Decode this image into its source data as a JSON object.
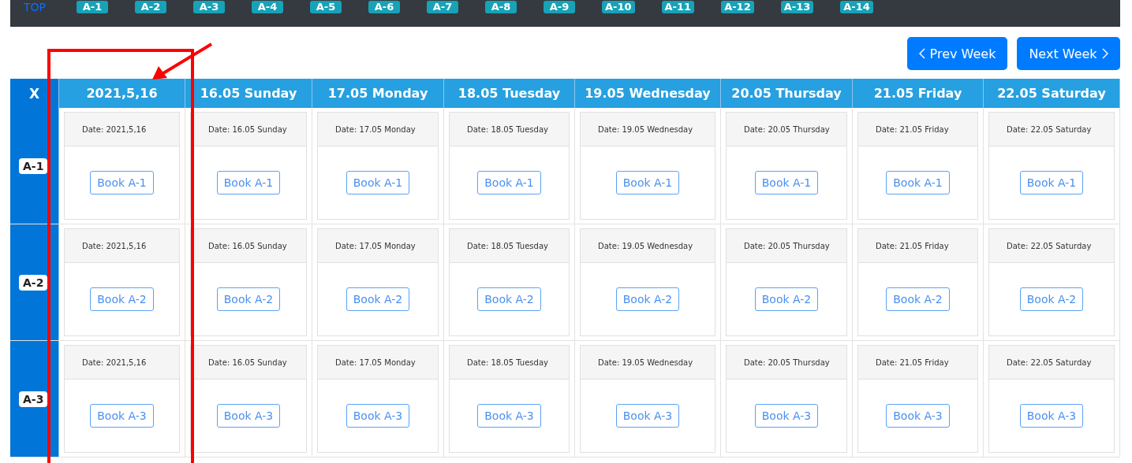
{
  "nav": {
    "top_link": "TOP",
    "badges": [
      "A-1",
      "A-2",
      "A-3",
      "A-4",
      "A-5",
      "A-6",
      "A-7",
      "A-8",
      "A-9",
      "A-10",
      "A-11",
      "A-12",
      "A-13",
      "A-14"
    ]
  },
  "week_buttons": [
    {
      "kind": "prev",
      "label": "Prev Week"
    },
    {
      "kind": "next",
      "label": "Next Week"
    }
  ],
  "table": {
    "corner": "X",
    "columns": [
      "2021,5,16",
      "16.05 Sunday",
      "17.05 Monday",
      "18.05 Tuesday",
      "19.05 Wednesday",
      "20.05 Thursday",
      "21.05 Friday",
      "22.05 Saturday"
    ],
    "rows": [
      {
        "label": "A-1",
        "cells": [
          {
            "date": "Date: 2021,5,16",
            "button": "Book A-1"
          },
          {
            "date": "Date: 16.05 Sunday",
            "button": "Book A-1"
          },
          {
            "date": "Date: 17.05 Monday",
            "button": "Book A-1"
          },
          {
            "date": "Date: 18.05 Tuesday",
            "button": "Book A-1"
          },
          {
            "date": "Date: 19.05 Wednesday",
            "button": "Book A-1"
          },
          {
            "date": "Date: 20.05 Thursday",
            "button": "Book A-1"
          },
          {
            "date": "Date: 21.05 Friday",
            "button": "Book A-1"
          },
          {
            "date": "Date: 22.05 Saturday",
            "button": "Book A-1"
          }
        ]
      },
      {
        "label": "A-2",
        "cells": [
          {
            "date": "Date: 2021,5,16",
            "button": "Book A-2"
          },
          {
            "date": "Date: 16.05 Sunday",
            "button": "Book A-2"
          },
          {
            "date": "Date: 17.05 Monday",
            "button": "Book A-2"
          },
          {
            "date": "Date: 18.05 Tuesday",
            "button": "Book A-2"
          },
          {
            "date": "Date: 19.05 Wednesday",
            "button": "Book A-2"
          },
          {
            "date": "Date: 20.05 Thursday",
            "button": "Book A-2"
          },
          {
            "date": "Date: 21.05 Friday",
            "button": "Book A-2"
          },
          {
            "date": "Date: 22.05 Saturday",
            "button": "Book A-2"
          }
        ]
      },
      {
        "label": "A-3",
        "cells": [
          {
            "date": "Date: 2021,5,16",
            "button": "Book A-3"
          },
          {
            "date": "Date: 16.05 Sunday",
            "button": "Book A-3"
          },
          {
            "date": "Date: 17.05 Monday",
            "button": "Book A-3"
          },
          {
            "date": "Date: 18.05 Tuesday",
            "button": "Book A-3"
          },
          {
            "date": "Date: 19.05 Wednesday",
            "button": "Book A-3"
          },
          {
            "date": "Date: 20.05 Thursday",
            "button": "Book A-3"
          },
          {
            "date": "Date: 21.05 Friday",
            "button": "Book A-3"
          },
          {
            "date": "Date: 22.05 Saturday",
            "button": "Book A-3"
          }
        ]
      }
    ]
  }
}
